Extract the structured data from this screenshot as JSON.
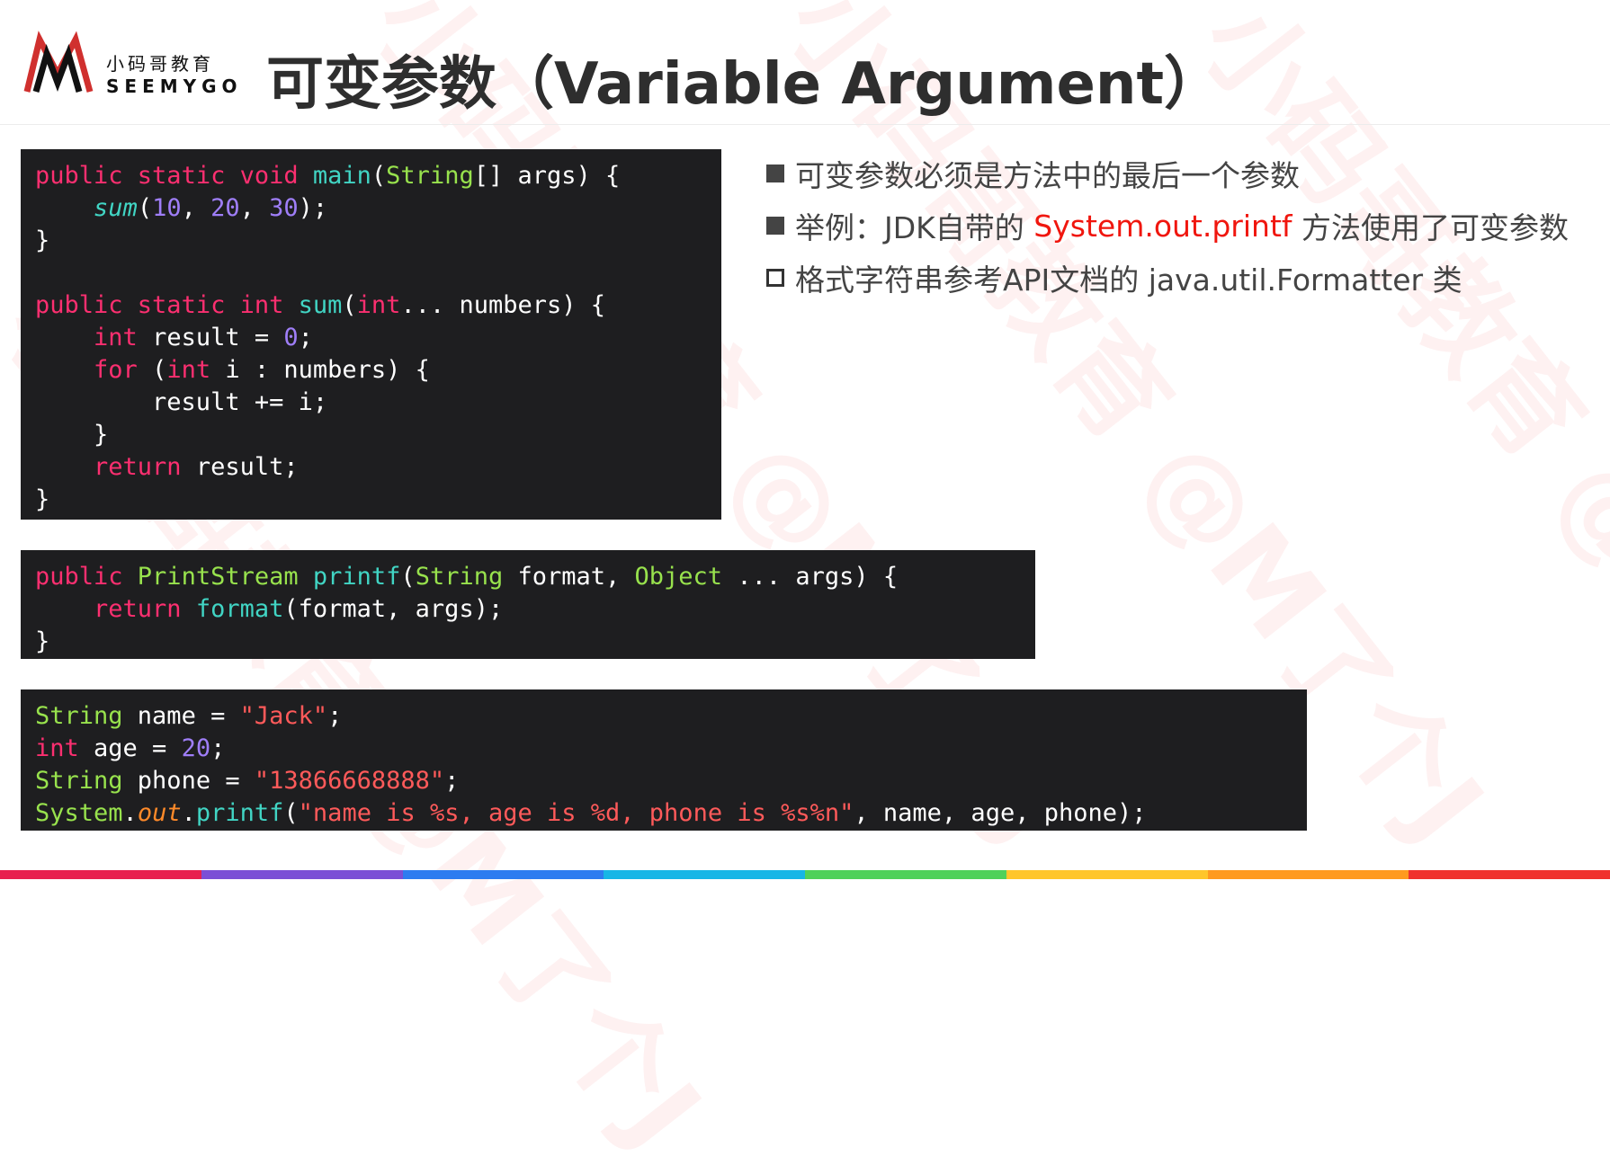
{
  "header": {
    "title": "可变参数（Variable Argument）",
    "logo": {
      "cn": "小码哥教育",
      "en": "SEEMYGO"
    }
  },
  "watermark": "小码哥教育 @M了个J",
  "code_blocks": [
    {
      "lines": [
        [
          [
            "public ",
            "k"
          ],
          [
            "static ",
            "k"
          ],
          [
            "void ",
            "k"
          ],
          [
            "main",
            "f"
          ],
          [
            "(",
            "w"
          ],
          [
            "String",
            "t"
          ],
          [
            "[] args) {",
            "w"
          ]
        ],
        [
          [
            "    ",
            "w"
          ],
          [
            "sum",
            "fi"
          ],
          [
            "(",
            "w"
          ],
          [
            "10",
            "n"
          ],
          [
            ", ",
            "w"
          ],
          [
            "20",
            "n"
          ],
          [
            ", ",
            "w"
          ],
          [
            "30",
            "n"
          ],
          [
            ");",
            "w"
          ]
        ],
        [
          [
            "}",
            "w"
          ]
        ],
        [
          [
            "",
            "w"
          ]
        ],
        [
          [
            "public ",
            "k"
          ],
          [
            "static ",
            "k"
          ],
          [
            "int ",
            "k"
          ],
          [
            "sum",
            "f"
          ],
          [
            "(",
            "w"
          ],
          [
            "int",
            "k"
          ],
          [
            "... numbers) {",
            "w"
          ]
        ],
        [
          [
            "    ",
            "w"
          ],
          [
            "int ",
            "k"
          ],
          [
            "result = ",
            "w"
          ],
          [
            "0",
            "n"
          ],
          [
            ";",
            "w"
          ]
        ],
        [
          [
            "    ",
            "w"
          ],
          [
            "for ",
            "k"
          ],
          [
            "(",
            "w"
          ],
          [
            "int ",
            "k"
          ],
          [
            "i : numbers) {",
            "w"
          ]
        ],
        [
          [
            "        result += i;",
            "w"
          ]
        ],
        [
          [
            "    }",
            "w"
          ]
        ],
        [
          [
            "    ",
            "w"
          ],
          [
            "return ",
            "k"
          ],
          [
            "result;",
            "w"
          ]
        ],
        [
          [
            "}",
            "w"
          ]
        ]
      ]
    },
    {
      "lines": [
        [
          [
            "public ",
            "k"
          ],
          [
            "PrintStream ",
            "t"
          ],
          [
            "printf",
            "f"
          ],
          [
            "(",
            "w"
          ],
          [
            "String ",
            "t"
          ],
          [
            "format, ",
            "w"
          ],
          [
            "Object ",
            "t"
          ],
          [
            "... args) {",
            "w"
          ]
        ],
        [
          [
            "    ",
            "w"
          ],
          [
            "return ",
            "k"
          ],
          [
            "format",
            "f"
          ],
          [
            "(format, args);",
            "w"
          ]
        ],
        [
          [
            "}",
            "w"
          ]
        ]
      ]
    },
    {
      "lines": [
        [
          [
            "String ",
            "t"
          ],
          [
            "name = ",
            "w"
          ],
          [
            "\"Jack\"",
            "s"
          ],
          [
            ";",
            "w"
          ]
        ],
        [
          [
            "int ",
            "k"
          ],
          [
            "age = ",
            "w"
          ],
          [
            "20",
            "n"
          ],
          [
            ";",
            "w"
          ]
        ],
        [
          [
            "String ",
            "t"
          ],
          [
            "phone = ",
            "w"
          ],
          [
            "\"13866668888\"",
            "s"
          ],
          [
            ";",
            "w"
          ]
        ],
        [
          [
            "System",
            "t"
          ],
          [
            ".",
            "w"
          ],
          [
            "out",
            "oi"
          ],
          [
            ".",
            "w"
          ],
          [
            "printf",
            "f"
          ],
          [
            "(",
            "w"
          ],
          [
            "\"name is %s, age is %d, phone is %s%n\"",
            "s"
          ],
          [
            ", name, age, phone);",
            "w"
          ]
        ]
      ]
    }
  ],
  "bullets": [
    {
      "marker": "filled",
      "parts": [
        {
          "text": "可变参数必须是方法中的最后一个参数"
        }
      ]
    },
    {
      "marker": "filled",
      "parts": [
        {
          "text": "举例：JDK自带的 "
        },
        {
          "text": "System.out.printf",
          "highlight": true
        },
        {
          "text": " 方法使用了可变参数"
        }
      ]
    },
    {
      "marker": "hollow",
      "parts": [
        {
          "text": "格式字符串参考API文档的 java.util.Formatter 类"
        }
      ]
    }
  ],
  "colors": {
    "code_bg": "#1e1e20",
    "keyword": "#fc2f70",
    "type": "#98e24d",
    "function": "#41d5c4",
    "number": "#9f7ef8",
    "string": "#ff5a5a",
    "static_field": "#ff8a29",
    "highlight": "#f0160e",
    "bottom_bar": [
      "#e8204f",
      "#7b4fd6",
      "#2d7cf0",
      "#16b6e6",
      "#4fd15a",
      "#ffc62a",
      "#ff9a1f",
      "#f0312d"
    ]
  }
}
